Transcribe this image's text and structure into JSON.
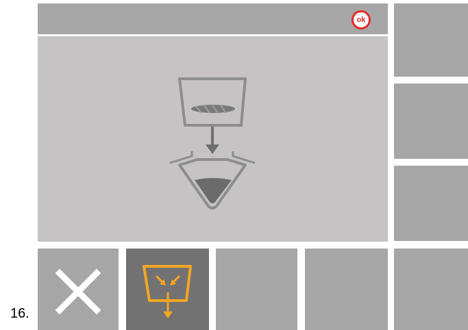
{
  "step": {
    "number_label": "16."
  },
  "header": {
    "confirm_label": "ok"
  },
  "main": {
    "illustration_icon": "fill-funnel-transfer-icon"
  },
  "side_buttons": [
    {
      "label": ""
    },
    {
      "label": ""
    },
    {
      "label": ""
    },
    {
      "label": ""
    }
  ],
  "bottom_buttons": [
    {
      "icon": "close-x-icon",
      "active": false
    },
    {
      "icon": "funnel-empty-icon",
      "active": true
    },
    {
      "icon": "",
      "active": false
    },
    {
      "icon": "",
      "active": false
    }
  ],
  "colors": {
    "panel": "#a6a6a6",
    "main_background": "#c5c3c4",
    "active_button": "#727272",
    "accent_orange": "#f5a623",
    "ok_red": "#e52a2a",
    "icon_gray": "#7a7a7a"
  }
}
